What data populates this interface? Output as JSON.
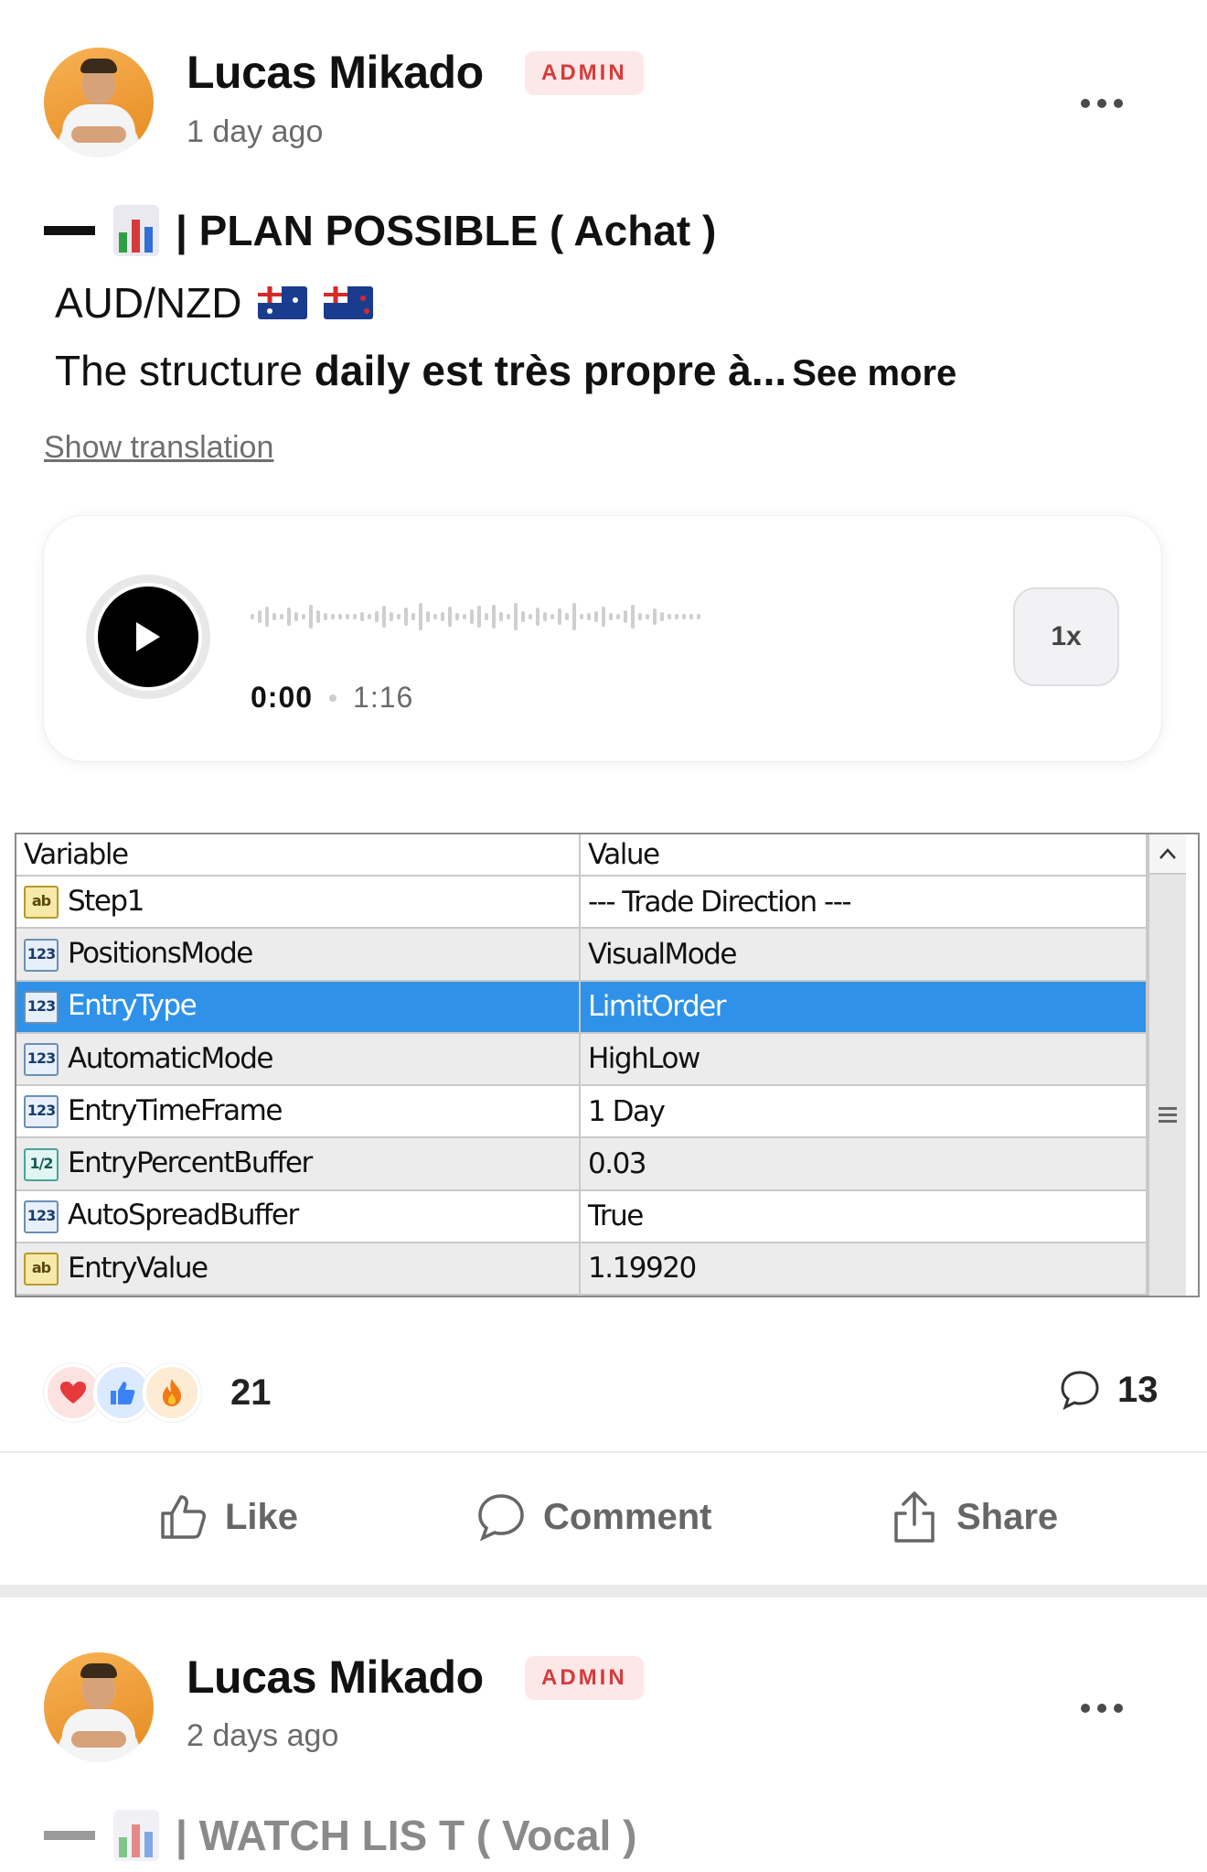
{
  "posts": [
    {
      "author": "Lucas Mikado",
      "badge": "ADMIN",
      "timestamp": "1 day ago",
      "title": "| PLAN POSSIBLE ( Achat )",
      "pair": "AUD/NZD",
      "excerpt_normal": "The structure ",
      "excerpt_bold": "daily est très propre à...",
      "see_more": "See more",
      "translation_link": "Show translation",
      "audio": {
        "current_time": "0:00",
        "duration": "1:16",
        "speed": "1x",
        "progress": 0
      },
      "params_table": {
        "headers": [
          "Variable",
          "Value"
        ],
        "rows": [
          {
            "type": "ab",
            "variable": "Step1",
            "value": "--- Trade Direction ---"
          },
          {
            "type": "123",
            "variable": "PositionsMode",
            "value": "VisualMode"
          },
          {
            "type": "123",
            "variable": "EntryType",
            "value": "LimitOrder",
            "selected": true
          },
          {
            "type": "123",
            "variable": "AutomaticMode",
            "value": "HighLow"
          },
          {
            "type": "123",
            "variable": "EntryTimeFrame",
            "value": "1 Day"
          },
          {
            "type": "1/2",
            "variable": "EntryPercentBuffer",
            "value": "0.03"
          },
          {
            "type": "123",
            "variable": "AutoSpreadBuffer",
            "value": "True"
          },
          {
            "type": "ab",
            "variable": "EntryValue",
            "value": "1.19920"
          }
        ]
      },
      "reaction_count": "21",
      "comment_count": "13",
      "actions": {
        "like": "Like",
        "comment": "Comment",
        "share": "Share"
      }
    },
    {
      "author": "Lucas Mikado",
      "badge": "ADMIN",
      "timestamp": "2 days ago",
      "title": "| WATCH LIS T ( Vocal )"
    }
  ],
  "icons": {
    "more": "more-horizontal-icon",
    "play": "play-icon",
    "comment": "speech-bubble-icon",
    "like": "thumbs-up-icon",
    "share": "share-icon",
    "chart": "bar-chart-icon"
  },
  "colors": {
    "badge_bg": "#fde8e8",
    "badge_text": "#d63b3b",
    "selection": "#2f92e8"
  }
}
